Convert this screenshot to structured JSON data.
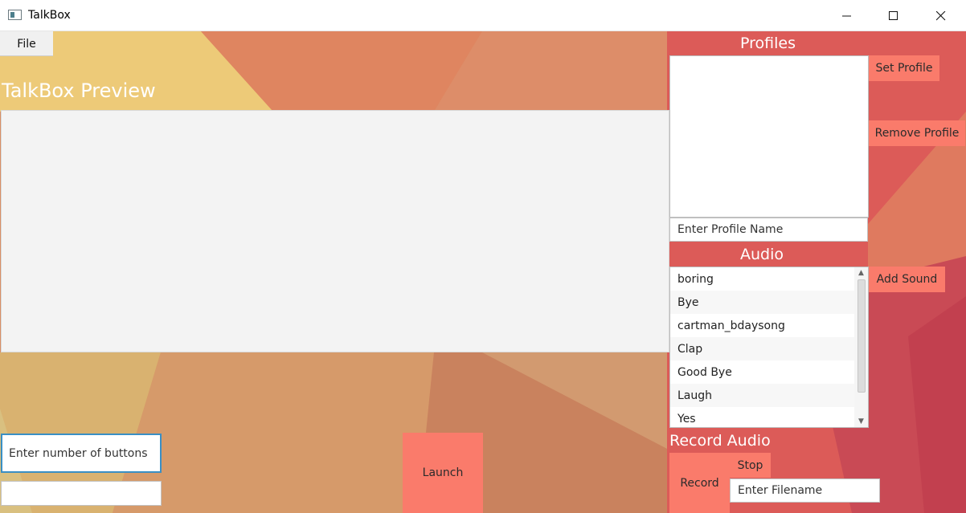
{
  "window": {
    "title": "TalkBox",
    "controls": {
      "minimize": "minimize-icon",
      "maximize": "maximize-icon",
      "close": "close-icon"
    }
  },
  "menu": {
    "file_label": "File"
  },
  "preview": {
    "title": "TalkBox Preview"
  },
  "profiles": {
    "title": "Profiles",
    "items": [],
    "set_label": "Set Profile",
    "remove_label": "Remove Profile",
    "name_placeholder": "Enter Profile Name"
  },
  "audio": {
    "title": "Audio",
    "items": [
      "boring",
      "Bye",
      "cartman_bdaysong",
      "Clap",
      "Good Bye",
      "Laugh",
      "Yes"
    ],
    "add_label": "Add Sound",
    "scroll_position": 0
  },
  "buttons": {
    "count_placeholder": "Enter number of buttons",
    "count_value": "",
    "second_field_value": "",
    "launch_label": "Launch"
  },
  "record": {
    "title": "Record Audio",
    "record_label": "Record",
    "stop_label": "Stop",
    "filename_placeholder": "Enter Filename"
  },
  "colors": {
    "accent": "#fa7b6b",
    "focus_border": "#3a8fc4",
    "heading_text": "#ffffff"
  }
}
